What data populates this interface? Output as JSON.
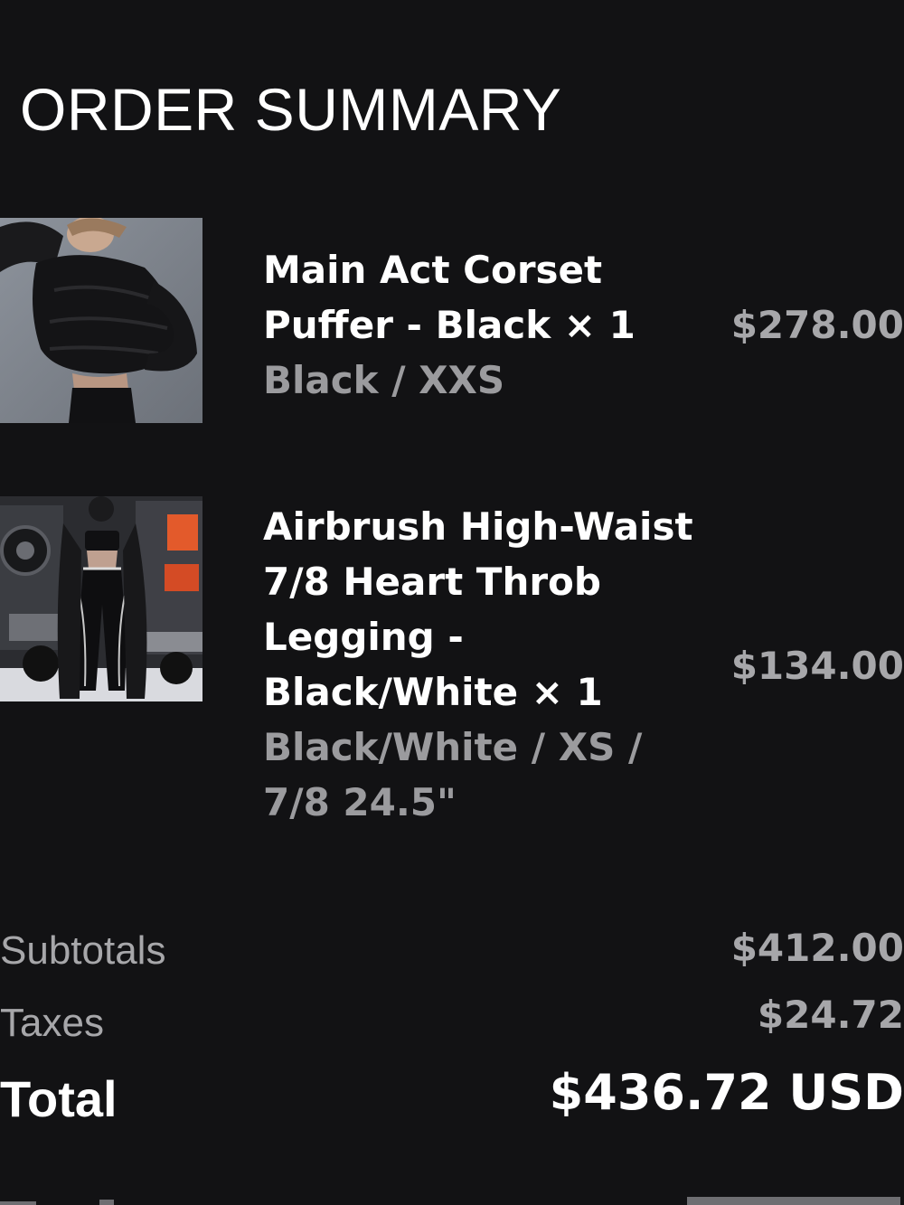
{
  "page": {
    "title": "ORDER SUMMARY"
  },
  "products": [
    {
      "name": "Main Act Corset Puffer - Black × 1",
      "variant": "Black / XXS",
      "price": "$278.00",
      "image_icon": "product-photo-puffer-jacket"
    },
    {
      "name": "Airbrush High-Waist 7/8 Heart Throb Legging - Black/White × 1",
      "variant": "Black/White / XS / 7/8 24.5\"",
      "price": "$134.00",
      "image_icon": "product-photo-legging-outfit"
    }
  ],
  "totals": {
    "subtotal_label": "Subtotals",
    "subtotal_value": "$412.00",
    "taxes_label": "Taxes",
    "taxes_value": "$24.72",
    "total_label": "Total",
    "total_value": "$436.72 USD"
  },
  "colors": {
    "background": "#121214",
    "primary_text": "#ffffff",
    "secondary_text": "#a7a7aa"
  }
}
